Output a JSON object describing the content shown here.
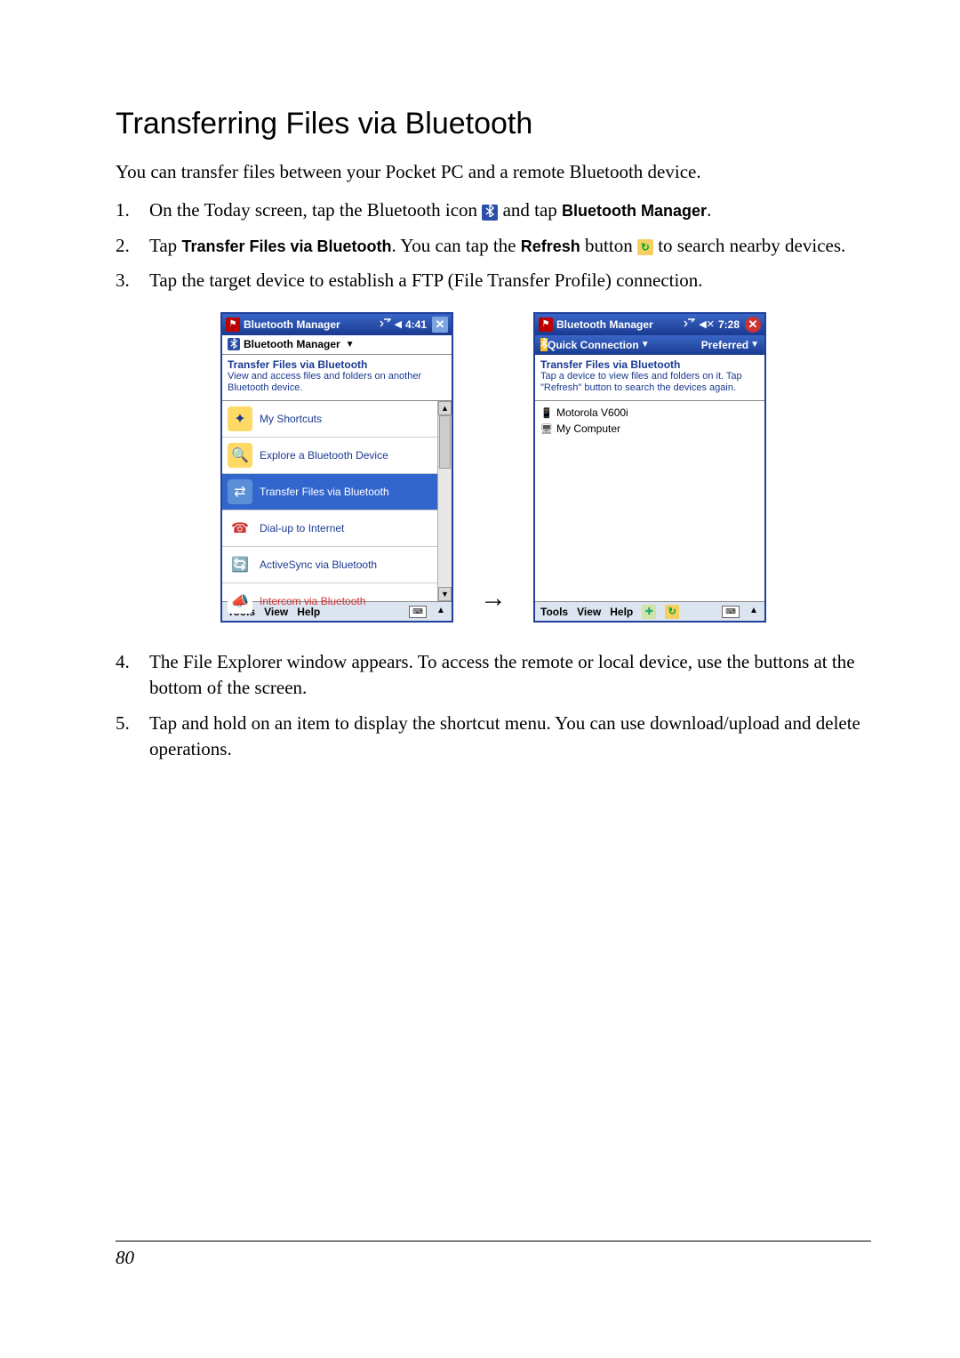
{
  "heading": "Transferring Files via Bluetooth",
  "intro": "You can transfer files between your Pocket PC and a remote Bluetooth device.",
  "steps": {
    "s1_a": "On the Today screen, tap the Bluetooth icon ",
    "s1_b": " and tap ",
    "s1_bold": "Bluetooth Manager",
    "s1_c": ".",
    "s2_a": "Tap ",
    "s2_bold1": "Transfer Files via Bluetooth",
    "s2_b": ". You can tap the ",
    "s2_bold2": "Refresh",
    "s2_c": " button ",
    "s2_d": " to search nearby devices.",
    "s3": "Tap the target device to establish a FTP (File Transfer Profile) connection.",
    "s4": "The File Explorer window appears. To access the remote or local device, use the buttons at the bottom of the screen.",
    "s5": "Tap and hold on an item to display the shortcut menu. You can use download/upload and delete operations."
  },
  "screen1": {
    "title": "Bluetooth Manager",
    "time": "4:41",
    "subbar": "Bluetooth Manager",
    "panel_title": "Transfer Files via Bluetooth",
    "panel_desc": "View and access files and folders on another Bluetooth device.",
    "items": [
      "My Shortcuts",
      "Explore a Bluetooth Device",
      "Transfer Files via Bluetooth",
      "Dial-up to Internet",
      "ActiveSync via Bluetooth",
      "Intercom via Bluetooth"
    ],
    "bottom": {
      "tools": "Tools",
      "view": "View",
      "help": "Help"
    }
  },
  "screen2": {
    "title": "Bluetooth Manager",
    "time": "7:28",
    "sub_quick": "Quick Connection",
    "sub_pref": "Preferred",
    "panel_title": "Transfer Files via Bluetooth",
    "panel_desc": "Tap a device to view files and folders on it. Tap \"Refresh\" button to search the devices again.",
    "devices": [
      "Motorola V600i",
      "My Computer"
    ],
    "bottom": {
      "tools": "Tools",
      "view": "View",
      "help": "Help"
    }
  },
  "page_number": "80"
}
